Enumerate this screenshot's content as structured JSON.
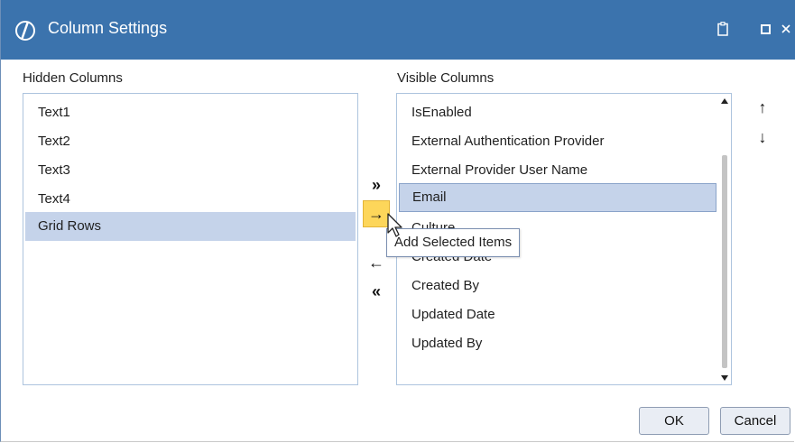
{
  "window": {
    "title": "Column Settings",
    "titlebar_color": "#3b73ad",
    "controls": [
      "clipboard-icon",
      "maximize-icon",
      "close-icon"
    ]
  },
  "hidden_columns": {
    "label": "Hidden Columns",
    "items": [
      "Text1",
      "Text2",
      "Text3",
      "Text4",
      "Grid Rows"
    ],
    "selected": "Grid Rows"
  },
  "visible_columns": {
    "label": "Visible Columns",
    "items": [
      "IsEnabled",
      "External Authentication Provider",
      "External Provider User Name",
      "Email",
      "Culture",
      "Created Date",
      "Created By",
      "Updated Date",
      "Updated By"
    ],
    "selected": "Email"
  },
  "move_buttons": {
    "add_all": "»",
    "add_selected": "→",
    "remove_selected": "←",
    "remove_all": "«"
  },
  "order_buttons": {
    "up": "↑",
    "down": "↓"
  },
  "tooltip": "Add Selected Items",
  "footer": {
    "ok_label": "OK",
    "cancel_label": "Cancel"
  },
  "colors": {
    "selection": "#c5d3ea",
    "hover_button": "#fdd65a"
  }
}
